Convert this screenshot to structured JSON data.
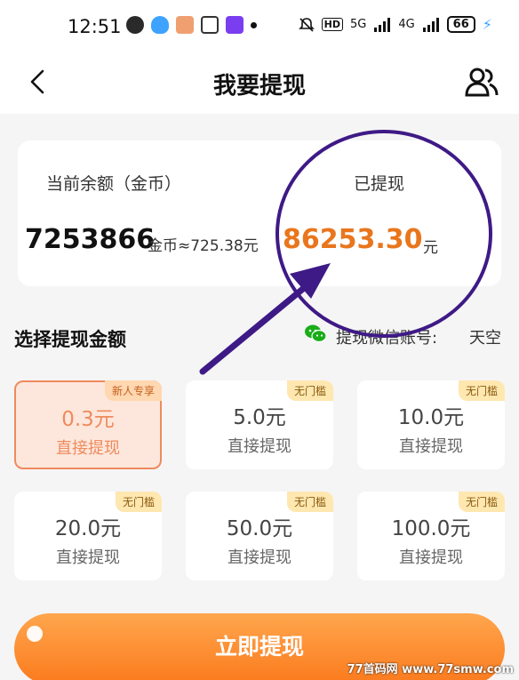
{
  "status_bar": {
    "time": "12:51",
    "hd": "HD",
    "network_5g": "5G",
    "network_4g": "4G",
    "battery": "66"
  },
  "nav": {
    "title": "我要提现",
    "back_icon": "chevron-left-icon",
    "user_icon": "users-icon"
  },
  "balance": {
    "label": "当前余额（金币）",
    "value": "7253866",
    "unit_text": "金币≈725.38元",
    "withdrawn_label": "已提现",
    "withdrawn_value": "86253.30",
    "withdrawn_unit": "元"
  },
  "section": {
    "title": "选择提现金额",
    "wechat_label": "提现微信账号:",
    "wechat_name": "天空"
  },
  "options": [
    {
      "badge": "新人专享",
      "amount": "0.3元",
      "sub": "直接提现"
    },
    {
      "badge": "无门槛",
      "amount": "5.0元",
      "sub": "直接提现"
    },
    {
      "badge": "无门槛",
      "amount": "10.0元",
      "sub": "直接提现"
    },
    {
      "badge": "无门槛",
      "amount": "20.0元",
      "sub": "直接提现"
    },
    {
      "badge": "无门槛",
      "amount": "50.0元",
      "sub": "直接提现"
    },
    {
      "badge": "无门槛",
      "amount": "100.0元",
      "sub": "直接提现"
    }
  ],
  "submit_label": "立即提现",
  "watermark": "77首码网 www.77smw.com",
  "colors": {
    "accent": "#e9761d",
    "annotation": "#3e1a86",
    "button": "#fb7a1d"
  }
}
